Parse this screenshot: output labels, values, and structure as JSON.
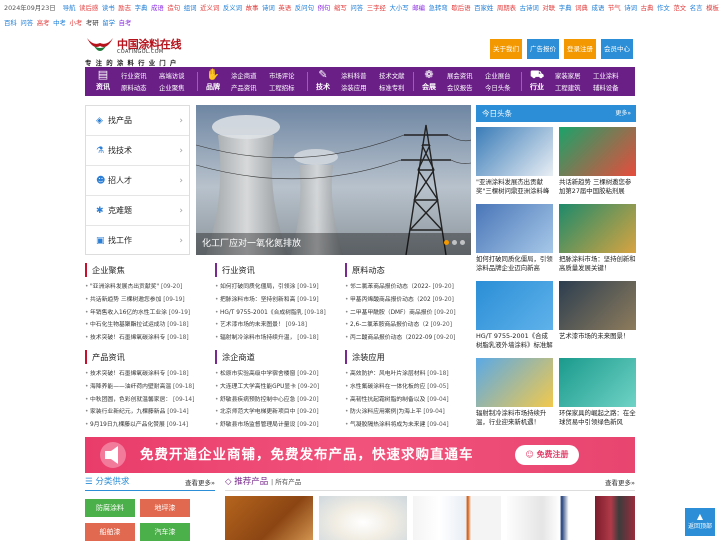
{
  "top": {
    "date": "2024年09月23日",
    "links": [
      {
        "t": "导航",
        "c": "#1a7cd6"
      },
      {
        "t": "读后感",
        "c": "#e23c3c"
      },
      {
        "t": "读书",
        "c": "#1a7cd6"
      },
      {
        "t": "励志",
        "c": "#e23c3c"
      },
      {
        "t": "字典",
        "c": "#1a7cd6"
      },
      {
        "t": "成语",
        "c": "#8a2be2"
      },
      {
        "t": "造句",
        "c": "#e23c3c"
      },
      {
        "t": "组词",
        "c": "#1a7cd6"
      },
      {
        "t": "近义词",
        "c": "#e23c3c"
      },
      {
        "t": "反义词",
        "c": "#1a7cd6"
      },
      {
        "t": "故事",
        "c": "#e23c3c"
      },
      {
        "t": "诗词",
        "c": "#1a7cd6"
      },
      {
        "t": "英语",
        "c": "#e23c3c"
      },
      {
        "t": "反问句",
        "c": "#1a7cd6"
      },
      {
        "t": "例句",
        "c": "#8a2be2"
      },
      {
        "t": "缩写",
        "c": "#e23c3c"
      },
      {
        "t": "问答",
        "c": "#1a7cd6"
      },
      {
        "t": "三字经",
        "c": "#e23c3c"
      },
      {
        "t": "大小写",
        "c": "#1a7cd6"
      },
      {
        "t": "邮编",
        "c": "#8a2be2"
      },
      {
        "t": "急转弯",
        "c": "#1a7cd6"
      },
      {
        "t": "歇后语",
        "c": "#e23c3c"
      },
      {
        "t": "百家姓",
        "c": "#1a7cd6"
      },
      {
        "t": "周期表",
        "c": "#e23c3c"
      },
      {
        "t": "古诗词",
        "c": "#1a7cd6"
      },
      {
        "t": "对联",
        "c": "#e23c3c"
      },
      {
        "t": "字典",
        "c": "#1a7cd6"
      },
      {
        "t": "词典",
        "c": "#e23c3c"
      },
      {
        "t": "成语",
        "c": "#1a7cd6"
      },
      {
        "t": "节气",
        "c": "#e23c3c"
      },
      {
        "t": "诗词",
        "c": "#1a7cd6"
      },
      {
        "t": "古典",
        "c": "#e23c3c"
      },
      {
        "t": "作文",
        "c": "#1a7cd6"
      },
      {
        "t": "范文",
        "c": "#e23c3c"
      },
      {
        "t": "名言",
        "c": "#1a7cd6"
      },
      {
        "t": "模板",
        "c": "#e23c3c"
      },
      {
        "t": "文档",
        "c": "#333333"
      },
      {
        "t": "诗词",
        "c": "#1a7cd6"
      },
      {
        "t": "国家",
        "c": "#e23c3c"
      }
    ],
    "links2": [
      {
        "t": "百科",
        "c": "#1a7cd6"
      },
      {
        "t": "问答",
        "c": "#1a7cd6"
      },
      {
        "t": "高考",
        "c": "#e23c3c"
      },
      {
        "t": "中考",
        "c": "#1a7cd6"
      },
      {
        "t": "小考",
        "c": "#e23c3c"
      },
      {
        "t": "考研",
        "c": "#333333"
      },
      {
        "t": "留学",
        "c": "#1a7cd6"
      },
      {
        "t": "自考",
        "c": "#8a2be2"
      }
    ]
  },
  "header": {
    "logo_text": "中国涂料在线",
    "logo_sub": "COATINGOL.COM",
    "slogan": "专 注 的 涂 料 行 业 门 户",
    "buttons": [
      {
        "label": "关于我们",
        "color": "#f39800"
      },
      {
        "label": "广告报价",
        "color": "#2b8ed6"
      },
      {
        "label": "登录注册",
        "color": "#f39800"
      },
      {
        "label": "会员中心",
        "color": "#2b8ed6"
      }
    ]
  },
  "nav": [
    {
      "head": "资讯",
      "icon": "news-icon",
      "glyph": "▤",
      "cols": [
        [
          "行业资讯",
          "原料动态"
        ],
        [
          "高端访谈",
          "企业聚焦"
        ]
      ]
    },
    {
      "head": "品牌",
      "icon": "brand-icon",
      "glyph": "✋",
      "cols": [
        [
          "涂企商道",
          "产品资讯"
        ],
        [
          "市场评论",
          "工程招标"
        ]
      ]
    },
    {
      "head": "技术",
      "icon": "tech-icon",
      "glyph": "✎",
      "cols": [
        [
          "涂料科普",
          "涂装应用"
        ],
        [
          "技术文献",
          "标准专利"
        ]
      ]
    },
    {
      "head": "会展",
      "icon": "expo-icon",
      "glyph": "❁",
      "cols": [
        [
          "展会资讯",
          "会议报告"
        ],
        [
          "企业展台",
          "今日头条"
        ]
      ]
    },
    {
      "head": "行业",
      "icon": "industry-icon",
      "glyph": "⛟",
      "cols": [
        [
          "家装家居",
          "工程建筑"
        ],
        [
          "工业涂料",
          "辅料设备"
        ]
      ]
    }
  ],
  "side_menu": [
    {
      "label": "找产品",
      "icon": "cube-icon",
      "glyph": "◈"
    },
    {
      "label": "找技术",
      "icon": "flask-icon",
      "glyph": "⚗"
    },
    {
      "label": "招人才",
      "icon": "person-icon",
      "glyph": "☻"
    },
    {
      "label": "克难题",
      "icon": "puzzle-icon",
      "glyph": "✱"
    },
    {
      "label": "找工作",
      "icon": "briefcase-icon",
      "glyph": "▣"
    }
  ],
  "hero": {
    "caption": "化工厂应对一氧化氮排放"
  },
  "news": {
    "title": "今日头条",
    "more": "更多»",
    "items": [
      {
        "cap": "\"亚洲涂料发展杰出贡献奖\"三棵树问鼎亚洲涂料峰",
        "c1": "#3a7cb8",
        "c2": "#e9eef4"
      },
      {
        "cap": "共话新趋势 三棵树邀您参加第27届中国胶粘剂展",
        "c1": "#1aa36a",
        "c2": "#e74c3c"
      },
      {
        "cap": "如何打破同质化僵局，引领涂料品牌企业迈向新高",
        "c1": "#4a76b8",
        "c2": "#a6c8e8"
      },
      {
        "cap": "把脉涂料市场：坚持创新和高质量发展关键！",
        "c1": "#1d8a6b",
        "c2": "#d9a441"
      },
      {
        "cap": "HG/T 9755-2001《合成树脂乳液外墙涂料》标准解",
        "c1": "#2b8ed6",
        "c2": "#5fb2ea"
      },
      {
        "cap": "艺术漆市场的未来图景！",
        "c1": "#2c3e50",
        "c2": "#8e7c5c"
      },
      {
        "cap": "辐射制冷涂料市场持续升温，行业迎来新机遇！",
        "c1": "#5aa9e6",
        "c2": "#f2c94c"
      },
      {
        "cap": "环保家具的崛起之路：在全球贸易中引领绿色新风",
        "c1": "#1a9a8c",
        "c2": "#6fd3c6"
      }
    ]
  },
  "columns": [
    {
      "title": "企业聚焦",
      "items": [
        [
          "\"亚洲涂料发展杰出贡献奖\"",
          "09-20"
        ],
        [
          "共话新趋势 三棵树邀您参加",
          "09-19"
        ],
        [
          "年销售收入16亿的水性工业涂",
          "09-19"
        ],
        [
          "中石化生物基聚酯拉试运成功",
          "09-18"
        ],
        [
          "技术突破！石墨烯氧碳涂料专",
          "09-18"
        ]
      ]
    },
    {
      "title": "行业资讯",
      "items": [
        [
          "如何打破同质化僵局，引领涂",
          "09-19"
        ],
        [
          "把脉涂料市场：坚持创新和高",
          "09-19"
        ],
        [
          "HG/T 9755-2001《合成树脂乳",
          "09-18"
        ],
        [
          "艺术漆市场的未来图景！",
          "09-18"
        ],
        [
          "辐射制冷涂料市场持续升温，",
          "09-18"
        ]
      ]
    },
    {
      "title": "原料动态",
      "items": [
        [
          "邻二氯苯商品报价动态（2022-",
          "09-20"
        ],
        [
          "甲基丙烯酸商品报价动态（202",
          "09-20"
        ],
        [
          "二甲基甲酰胺（DMF）商品报价",
          "09-20"
        ],
        [
          "2,6-二氯苯胺商品报价动态（2",
          "09-20"
        ],
        [
          "丙二酸商品报价动态（2022-09",
          "09-20"
        ]
      ]
    },
    {
      "title": "产品资讯",
      "items": [
        [
          "技术突破！石墨烯氧碳涂料专",
          "09-18"
        ],
        [
          "海降养能——油纤荷内壁耐高温",
          "09-18"
        ],
        [
          "中秋团圆，色彩创就温馨家居：",
          "09-14"
        ],
        [
          "家装行业新纪元，九棵藤新品",
          "09-14"
        ],
        [
          "9月19日九棵藤以产品化赞展",
          "09-14"
        ]
      ]
    },
    {
      "title": "涂企商道",
      "items": [
        [
          "松原市实验高级中学宿舍楼窗",
          "09-20"
        ],
        [
          "大连理工大学高性能GPU显卡",
          "09-20"
        ],
        [
          "舒敏县疾病预防控制中心应急",
          "09-20"
        ],
        [
          "北京师范大学电梯更新项目中",
          "09-20"
        ],
        [
          "舒敏县市场监督管理局计量设",
          "09-20"
        ]
      ]
    },
    {
      "title": "涂装应用",
      "items": [
        [
          "高效防护：风电叶片涂层材料",
          "09-18"
        ],
        [
          "水性氟碳涂料在一体化板的应",
          "09-05"
        ],
        [
          "高韧性抗起霜树脂的制备以及",
          "09-04"
        ],
        [
          "防火涂料应用案例|为海上平",
          "09-04"
        ],
        [
          "气凝胶隔热涂料将成为未来建",
          "09-04"
        ]
      ]
    }
  ],
  "banner": {
    "text": "免费开通企业商铺，免费发布产品，快速求购直通车",
    "button": "免费注册"
  },
  "bottom": {
    "cat_title": "分类供求",
    "cat_more": "查看更多»",
    "cats": [
      {
        "label": "防腐涂料",
        "color": "#4cb04a"
      },
      {
        "label": "地坪漆",
        "color": "#e0694f"
      },
      {
        "label": "船舶漆",
        "color": "#e0694f"
      },
      {
        "label": "汽车漆",
        "color": "#4cb04a"
      }
    ],
    "prod_title": "推荐产品",
    "prod_sub": "| 所有产品",
    "prod_more": "查看更多»"
  },
  "to_top": "返回顶部"
}
